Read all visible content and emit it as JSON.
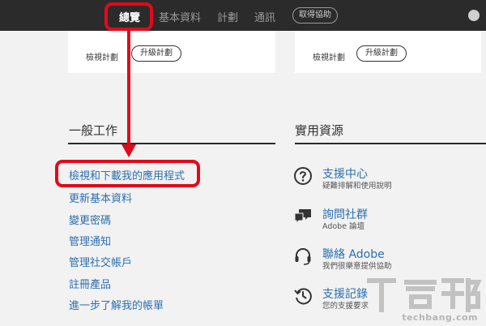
{
  "nav": {
    "items": [
      {
        "label": "總覽",
        "active": true
      },
      {
        "label": "基本資料",
        "active": false
      },
      {
        "label": "計劃",
        "active": false
      },
      {
        "label": "通訊",
        "active": false
      }
    ],
    "pill_label": "取得協助"
  },
  "cards": [
    {
      "link": "檢視計劃",
      "button": "升級計劃"
    },
    {
      "link": "檢視計劃",
      "button": "升級計劃"
    }
  ],
  "general_tasks": {
    "heading": "一般工作",
    "links": [
      "檢視和下載我的應用程式",
      "更新基本資料",
      "變更密碼",
      "管理通知",
      "管理社交帳戶",
      "註冊產品",
      "進一步了解我的帳單"
    ]
  },
  "resources": {
    "heading": "實用資源",
    "items": [
      {
        "title": "支援中心",
        "subtitle": "疑難排解和使用說明",
        "icon": "question-circle-icon"
      },
      {
        "title": "詢問社群",
        "subtitle": "Adobe 論壇",
        "icon": "chat-bubbles-icon"
      },
      {
        "title": "聯絡 Adobe",
        "subtitle": "我們很樂意提供協助",
        "icon": "headset-icon"
      },
      {
        "title": "支援記錄",
        "subtitle": "您的支援要求",
        "icon": "history-clock-icon"
      }
    ]
  },
  "watermark": {
    "logo_text": "T客邦",
    "site": "techbang.com"
  },
  "colors": {
    "nav_bg": "#2b2b2b",
    "link": "#2c6fb0",
    "annotation": "#e3081a",
    "page_bg": "#f2f2f2"
  }
}
